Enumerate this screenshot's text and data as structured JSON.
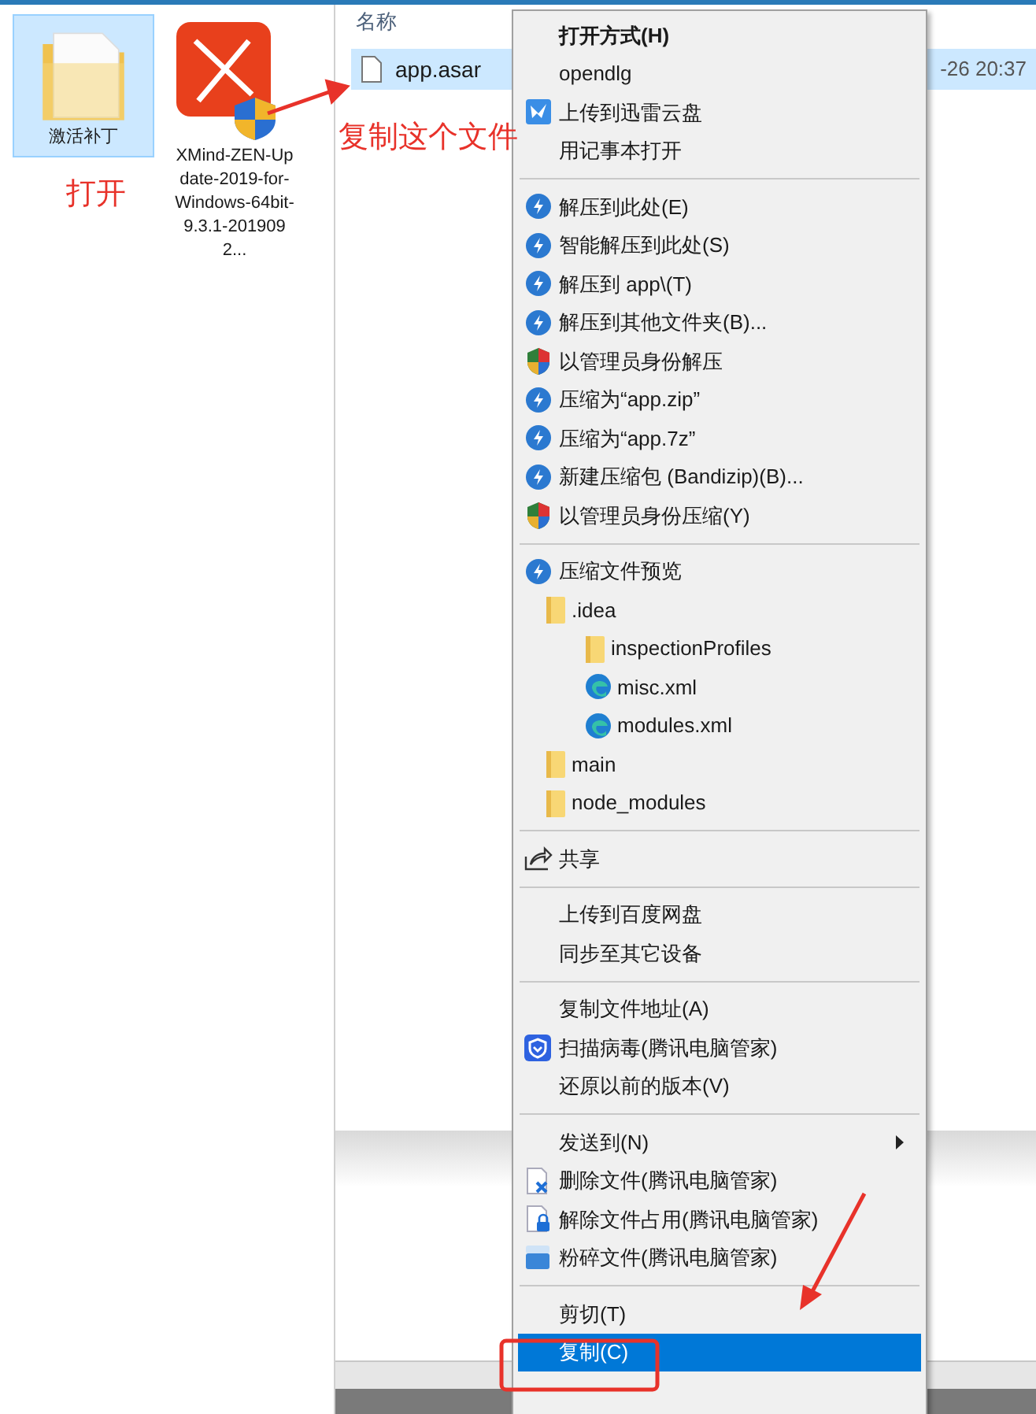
{
  "desktop": {
    "items": [
      {
        "label": "激活补丁",
        "kind": "folder",
        "selected": true
      },
      {
        "label": "XMind-ZEN-Update-2019-for-Windows-64bit-9.3.1-2019092...",
        "kind": "app",
        "selected": false
      }
    ]
  },
  "explorer": {
    "columns": [
      "名称"
    ],
    "rows": [
      {
        "name": "app.asar",
        "modified": "-26 20:37",
        "selected": true
      }
    ]
  },
  "context_menu": {
    "sections": [
      [
        {
          "label": "打开方式(H)",
          "kind": "plain",
          "default": true,
          "submenu": false,
          "selected": false
        },
        {
          "label": "opendlg",
          "kind": "plain",
          "default": false,
          "submenu": false,
          "selected": false
        },
        {
          "label": "上传到迅雷云盘",
          "kind": "bird",
          "default": false,
          "submenu": false,
          "selected": false
        },
        {
          "label": "用记事本打开",
          "kind": "plain",
          "default": false,
          "submenu": false,
          "selected": false
        }
      ],
      [
        {
          "label": "解压到此处(E)",
          "kind": "bolt",
          "default": false,
          "submenu": false,
          "selected": false
        },
        {
          "label": "智能解压到此处(S)",
          "kind": "bolt",
          "default": false,
          "submenu": false,
          "selected": false
        },
        {
          "label": "解压到 app\\(T)",
          "kind": "bolt",
          "default": false,
          "submenu": false,
          "selected": false
        },
        {
          "label": "解压到其他文件夹(B)...",
          "kind": "bolt",
          "default": false,
          "submenu": false,
          "selected": false
        },
        {
          "label": "以管理员身份解压",
          "kind": "shield",
          "default": false,
          "submenu": false,
          "selected": false
        },
        {
          "label": "压缩为“app.zip”",
          "kind": "bolt",
          "default": false,
          "submenu": false,
          "selected": false
        },
        {
          "label": "压缩为“app.7z”",
          "kind": "bolt",
          "default": false,
          "submenu": false,
          "selected": false
        },
        {
          "label": "新建压缩包 (Bandizip)(B)...",
          "kind": "bolt",
          "default": false,
          "submenu": false,
          "selected": false
        },
        {
          "label": "以管理员身份压缩(Y)",
          "kind": "shield",
          "default": false,
          "submenu": false,
          "selected": false
        }
      ],
      [
        {
          "label": "压缩文件预览",
          "kind": "bolt",
          "default": false,
          "submenu": false,
          "selected": false,
          "children": [
            {
              "label": ".idea",
              "kind": "folder",
              "children": [
                {
                  "label": "inspectionProfiles",
                  "kind": "folder"
                },
                {
                  "label": "misc.xml",
                  "kind": "web"
                },
                {
                  "label": "modules.xml",
                  "kind": "web"
                }
              ]
            },
            {
              "label": "main",
              "kind": "folder"
            },
            {
              "label": "node_modules",
              "kind": "folder"
            }
          ]
        }
      ],
      [
        {
          "label": "共享",
          "kind": "share",
          "default": false,
          "submenu": false,
          "selected": false
        }
      ],
      [
        {
          "label": "上传到百度网盘",
          "kind": "plain",
          "default": false,
          "submenu": false,
          "selected": false
        },
        {
          "label": "同步至其它设备",
          "kind": "plain",
          "default": false,
          "submenu": false,
          "selected": false
        }
      ],
      [
        {
          "label": "复制文件地址(A)",
          "kind": "plain",
          "default": false,
          "submenu": false,
          "selected": false
        },
        {
          "label": "扫描病毒(腾讯电脑管家)",
          "kind": "guard",
          "default": false,
          "submenu": false,
          "selected": false
        },
        {
          "label": "还原以前的版本(V)",
          "kind": "plain",
          "default": false,
          "submenu": false,
          "selected": false
        }
      ],
      [
        {
          "label": "发送到(N)",
          "kind": "plain",
          "default": false,
          "submenu": true,
          "selected": false
        },
        {
          "label": "删除文件(腾讯电脑管家)",
          "kind": "delete",
          "default": false,
          "submenu": false,
          "selected": false
        },
        {
          "label": "解除文件占用(腾讯电脑管家)",
          "kind": "unlock",
          "default": false,
          "submenu": false,
          "selected": false
        },
        {
          "label": "粉碎文件(腾讯电脑管家)",
          "kind": "shred",
          "default": false,
          "submenu": false,
          "selected": false
        }
      ],
      [
        {
          "label": "剪切(T)",
          "kind": "plain",
          "default": false,
          "submenu": false,
          "selected": false
        },
        {
          "label": "复制(C)",
          "kind": "plain",
          "default": false,
          "submenu": false,
          "selected": true
        }
      ]
    ]
  },
  "annotations": [
    {
      "text": "复制这个文件"
    },
    {
      "text": "打开"
    }
  ]
}
